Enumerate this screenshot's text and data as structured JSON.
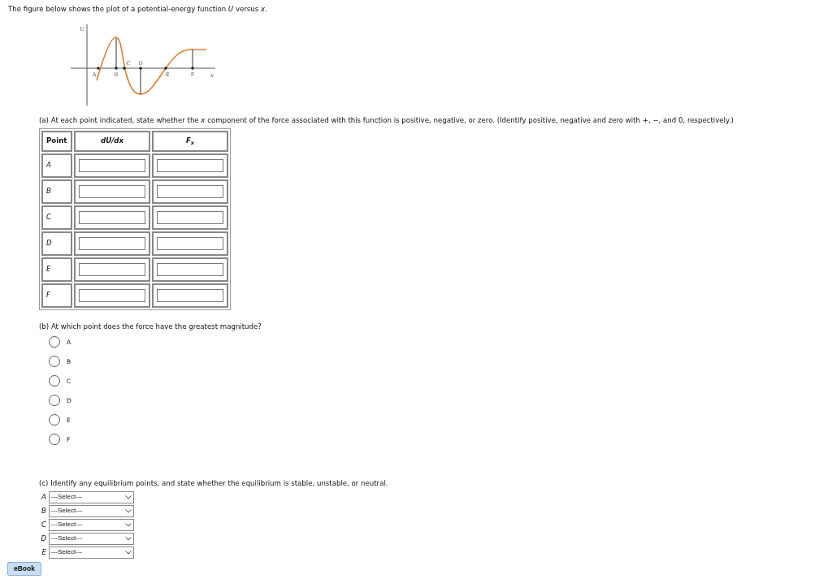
{
  "intro": "The figure below shows the plot of a potential-energy function *U* versus *x*.",
  "figure": {
    "vertical_axis_label": "U",
    "horizontal_axis_label": "x",
    "points": [
      "A",
      "B",
      "C",
      "D",
      "E",
      "F"
    ]
  },
  "part_a": {
    "prompt": "(a) At each point indicated, state whether the *x* component of the force associated with this function is positive, negative, or zero. (Identify positive, negative and zero with +, −, and 0, respectively.)",
    "columns": [
      "Point",
      "dU/dx",
      "F$_{x}$"
    ],
    "rows": [
      {
        "point": "A"
      },
      {
        "point": "B"
      },
      {
        "point": "C"
      },
      {
        "point": "D"
      },
      {
        "point": "E"
      },
      {
        "point": "F"
      }
    ]
  },
  "part_b": {
    "prompt": "(b) At which point does the force have the greatest magnitude?",
    "options": [
      {
        "label": "A",
        "selected": false
      },
      {
        "label": "B",
        "selected": false
      },
      {
        "label": "C",
        "selected": false
      },
      {
        "label": "D",
        "selected": false
      },
      {
        "label": "E",
        "selected": false
      },
      {
        "label": "F",
        "selected": false
      }
    ]
  },
  "part_c": {
    "prompt": "(c) Identify any equilibrium points, and state whether the equilibrium is stable, unstable, or neutral.",
    "rows": [
      {
        "point": "A",
        "value": "---Select---"
      },
      {
        "point": "B",
        "value": "---Select---"
      },
      {
        "point": "C",
        "value": "---Select---"
      },
      {
        "point": "D",
        "value": "---Select---"
      },
      {
        "point": "E",
        "value": "---Select---"
      }
    ]
  },
  "ebook_button": "eBook"
}
